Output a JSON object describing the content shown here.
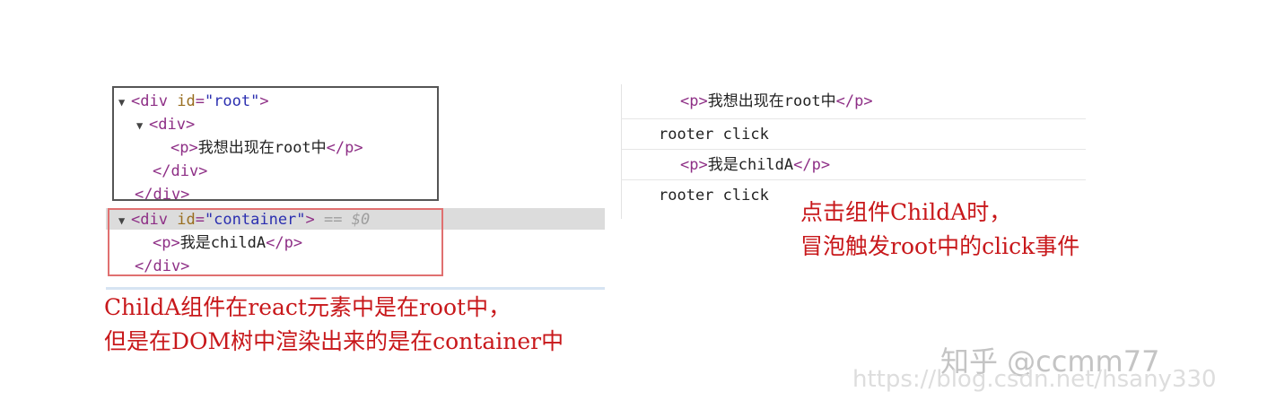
{
  "elements_panel": {
    "lines": [
      {
        "open_tag": "<div",
        "attr_name": "id",
        "eq": "=",
        "attr_value": "\"root\"",
        "close": ">"
      },
      {
        "tag": "<div>"
      },
      {
        "open": "<p>",
        "text": "我想出现在root中",
        "close": "</p>"
      },
      {
        "tag": "</div>"
      },
      {
        "tag": "</div>"
      },
      {
        "open_tag": "<div",
        "attr_name": "id",
        "eq": "=",
        "attr_value": "\"container\"",
        "close": ">",
        "selected_marker": "== $0"
      },
      {
        "open": "<p>",
        "text": "我是childA",
        "close": "</p>"
      },
      {
        "tag": "</div>"
      }
    ]
  },
  "console_panel": {
    "rows": [
      {
        "open": "<p>",
        "text": "我想出现在root中",
        "close": "</p>"
      },
      {
        "text": "rooter click"
      },
      {
        "open": "<p>",
        "text": "我是childA",
        "close": "</p>"
      },
      {
        "text": "rooter click"
      }
    ]
  },
  "annotations": {
    "right_line1": "点击组件ChildA时，",
    "right_line2": "冒泡触发root中的click事件",
    "left_line1": "ChildA组件在react元素中是在root中，",
    "left_line2": "但是在DOM树中渲染出来的是在container中"
  },
  "watermark": {
    "main": "知乎 @ccmm77",
    "url": "https://blog.csdn.net/hsany330"
  },
  "colors": {
    "annotation_red": "#c8181b",
    "root_box_border": "#555555",
    "container_box_border": "#e07070",
    "tag_color": "#8e2f86",
    "attr_value_color": "#2b2fb0"
  },
  "icons": {
    "expand": "triangle-down-icon"
  }
}
